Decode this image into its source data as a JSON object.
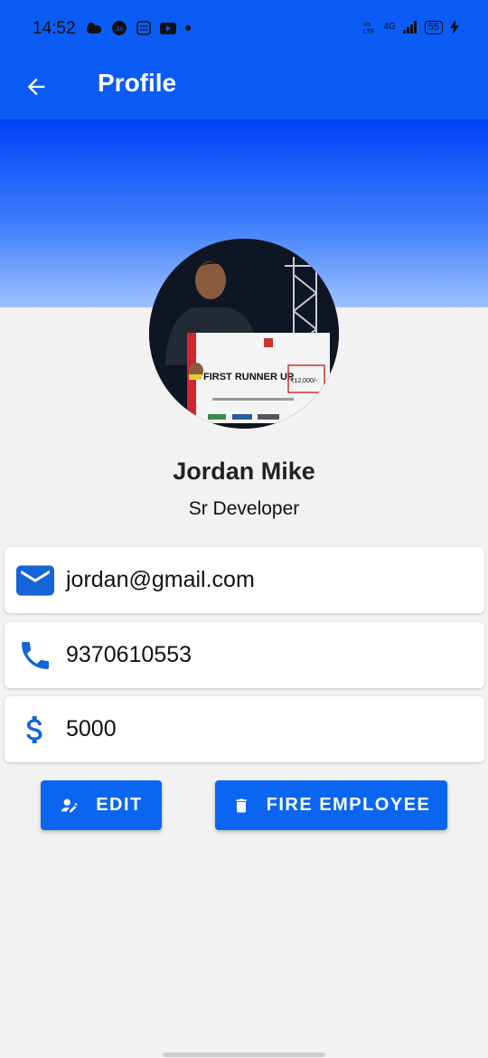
{
  "status_bar": {
    "time": "14:52",
    "battery": "55",
    "network": "4G"
  },
  "app_bar": {
    "title": "Profile"
  },
  "profile": {
    "name": "Jordan Mike",
    "role": "Sr Developer",
    "photo_caption": "FIRST RUNNER UP",
    "photo_amount": "₹12,000/-"
  },
  "details": {
    "email": "jordan@gmail.com",
    "phone": "9370610553",
    "salary": "5000"
  },
  "actions": {
    "edit_label": "EDIT",
    "fire_label": "FIRE EMPLOYEE"
  },
  "colors": {
    "primary": "#0a5cf5",
    "button": "#0a66f0",
    "icon": "#1565d8"
  }
}
